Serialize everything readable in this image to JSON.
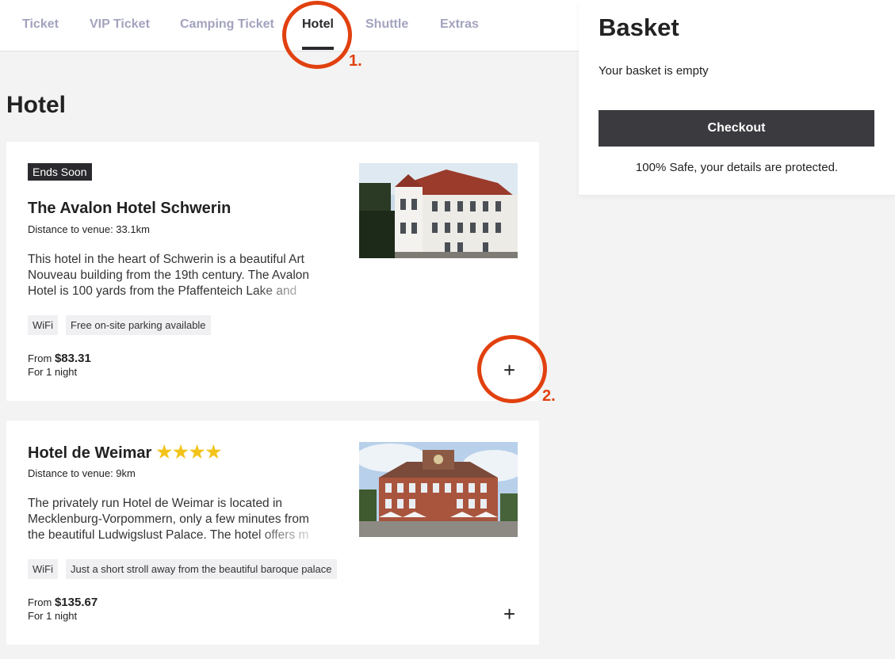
{
  "nav": {
    "tabs": [
      {
        "label": "Ticket"
      },
      {
        "label": "VIP Ticket"
      },
      {
        "label": "Camping Ticket"
      },
      {
        "label": "Hotel"
      },
      {
        "label": "Shuttle"
      },
      {
        "label": "Extras"
      }
    ],
    "active": "Hotel"
  },
  "annotations": {
    "step1": "1.",
    "step2": "2."
  },
  "page_title": "Hotel",
  "hotels": [
    {
      "badge": "Ends Soon",
      "name": "The Avalon Hotel Schwerin",
      "distance": "Distance to venue: 33.1km",
      "description": "This hotel in the heart of Schwerin is a beautiful Art Nouveau building from the 19th century. The Avalon Hotel is 100 yards from the Pfaffenteich Lake and",
      "amenities": [
        "WiFi",
        "Free on-site parking available"
      ],
      "price_prefix": "From",
      "price": "$83.31",
      "duration": "For 1 night",
      "add_icon": "+"
    },
    {
      "name": "Hotel de Weimar",
      "stars": "★★★★",
      "star_rating": 4,
      "distance": "Distance to venue: 9km",
      "description": "The privately run Hotel de Weimar is located in Mecklenburg-Vorpommern, only a few minutes from the beautiful Ludwigslust Palace. The hotel offers m",
      "amenities": [
        "WiFi",
        "Just a short stroll away from the beautiful baroque palace"
      ],
      "price_prefix": "From",
      "price": "$135.67",
      "duration": "For 1 night",
      "add_icon": "+"
    }
  ],
  "basket": {
    "title": "Basket",
    "empty_text": "Your basket is empty",
    "checkout_label": "Checkout",
    "safe_text": "100% Safe, your details are protected."
  },
  "colors": {
    "accent_dark": "#2a2a2e",
    "tab_inactive": "#a3a3bf",
    "annotation": "#e1400f",
    "stars": "#f2c31a"
  }
}
